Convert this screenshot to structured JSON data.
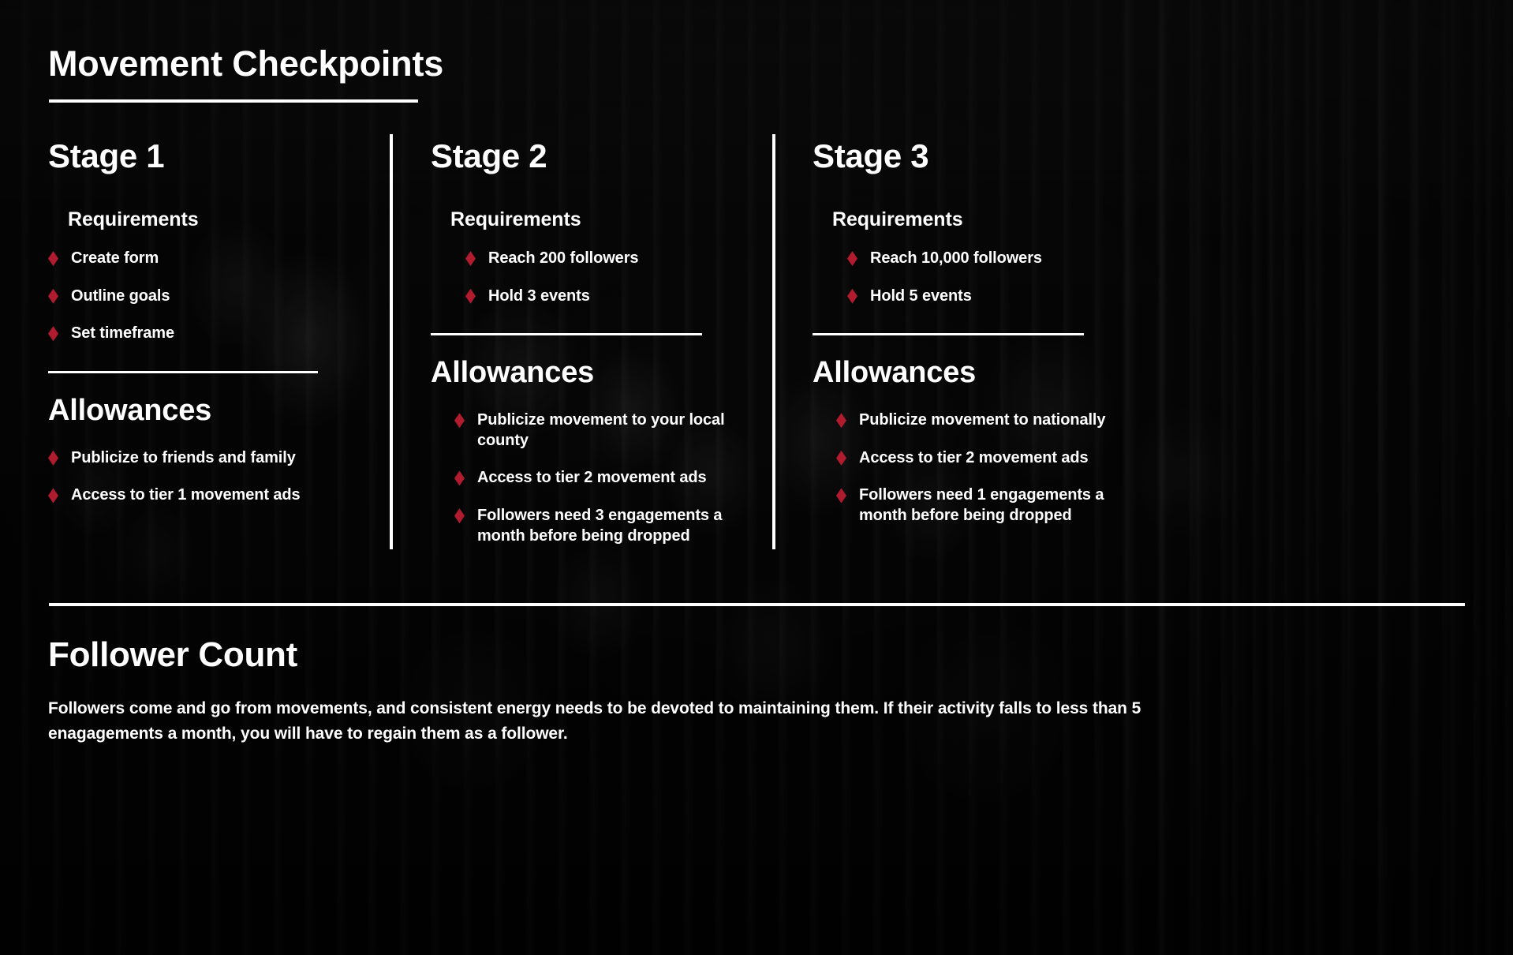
{
  "slide": {
    "title": "Movement Checkpoints",
    "accent_color": "#b01b2e",
    "text_color": "#ffffff",
    "background_color": "#060606",
    "bullet_icon": "diamond-icon"
  },
  "stages": [
    {
      "name": "Stage 1",
      "requirements_heading": "Requirements",
      "requirements": [
        "Create form",
        "Outline goals",
        "Set timeframe"
      ],
      "allowances_heading": "Allowances",
      "allowances": [
        "Publicize to friends and family",
        "Access to tier 1 movement ads"
      ]
    },
    {
      "name": "Stage 2",
      "requirements_heading": "Requirements",
      "requirements": [
        "Reach 200 followers",
        "Hold 3 events"
      ],
      "allowances_heading": "Allowances",
      "allowances": [
        "Publicize movement to your local county",
        "Access to tier 2 movement ads",
        "Followers need 3 engagements a month before being dropped"
      ]
    },
    {
      "name": "Stage 3",
      "requirements_heading": "Requirements",
      "requirements": [
        "Reach 10,000 followers",
        "Hold 5 events"
      ],
      "allowances_heading": "Allowances",
      "allowances": [
        "Publicize movement to nationally",
        "Access to tier 2 movement ads",
        "Followers need 1 engagements a month before being dropped"
      ]
    }
  ],
  "footer": {
    "title": "Follower Count",
    "body": "Followers come and go from movements, and consistent energy needs to be devoted to maintaining them. If their activity falls to less than 5 enagagements a month, you will have to regain them as a follower."
  }
}
